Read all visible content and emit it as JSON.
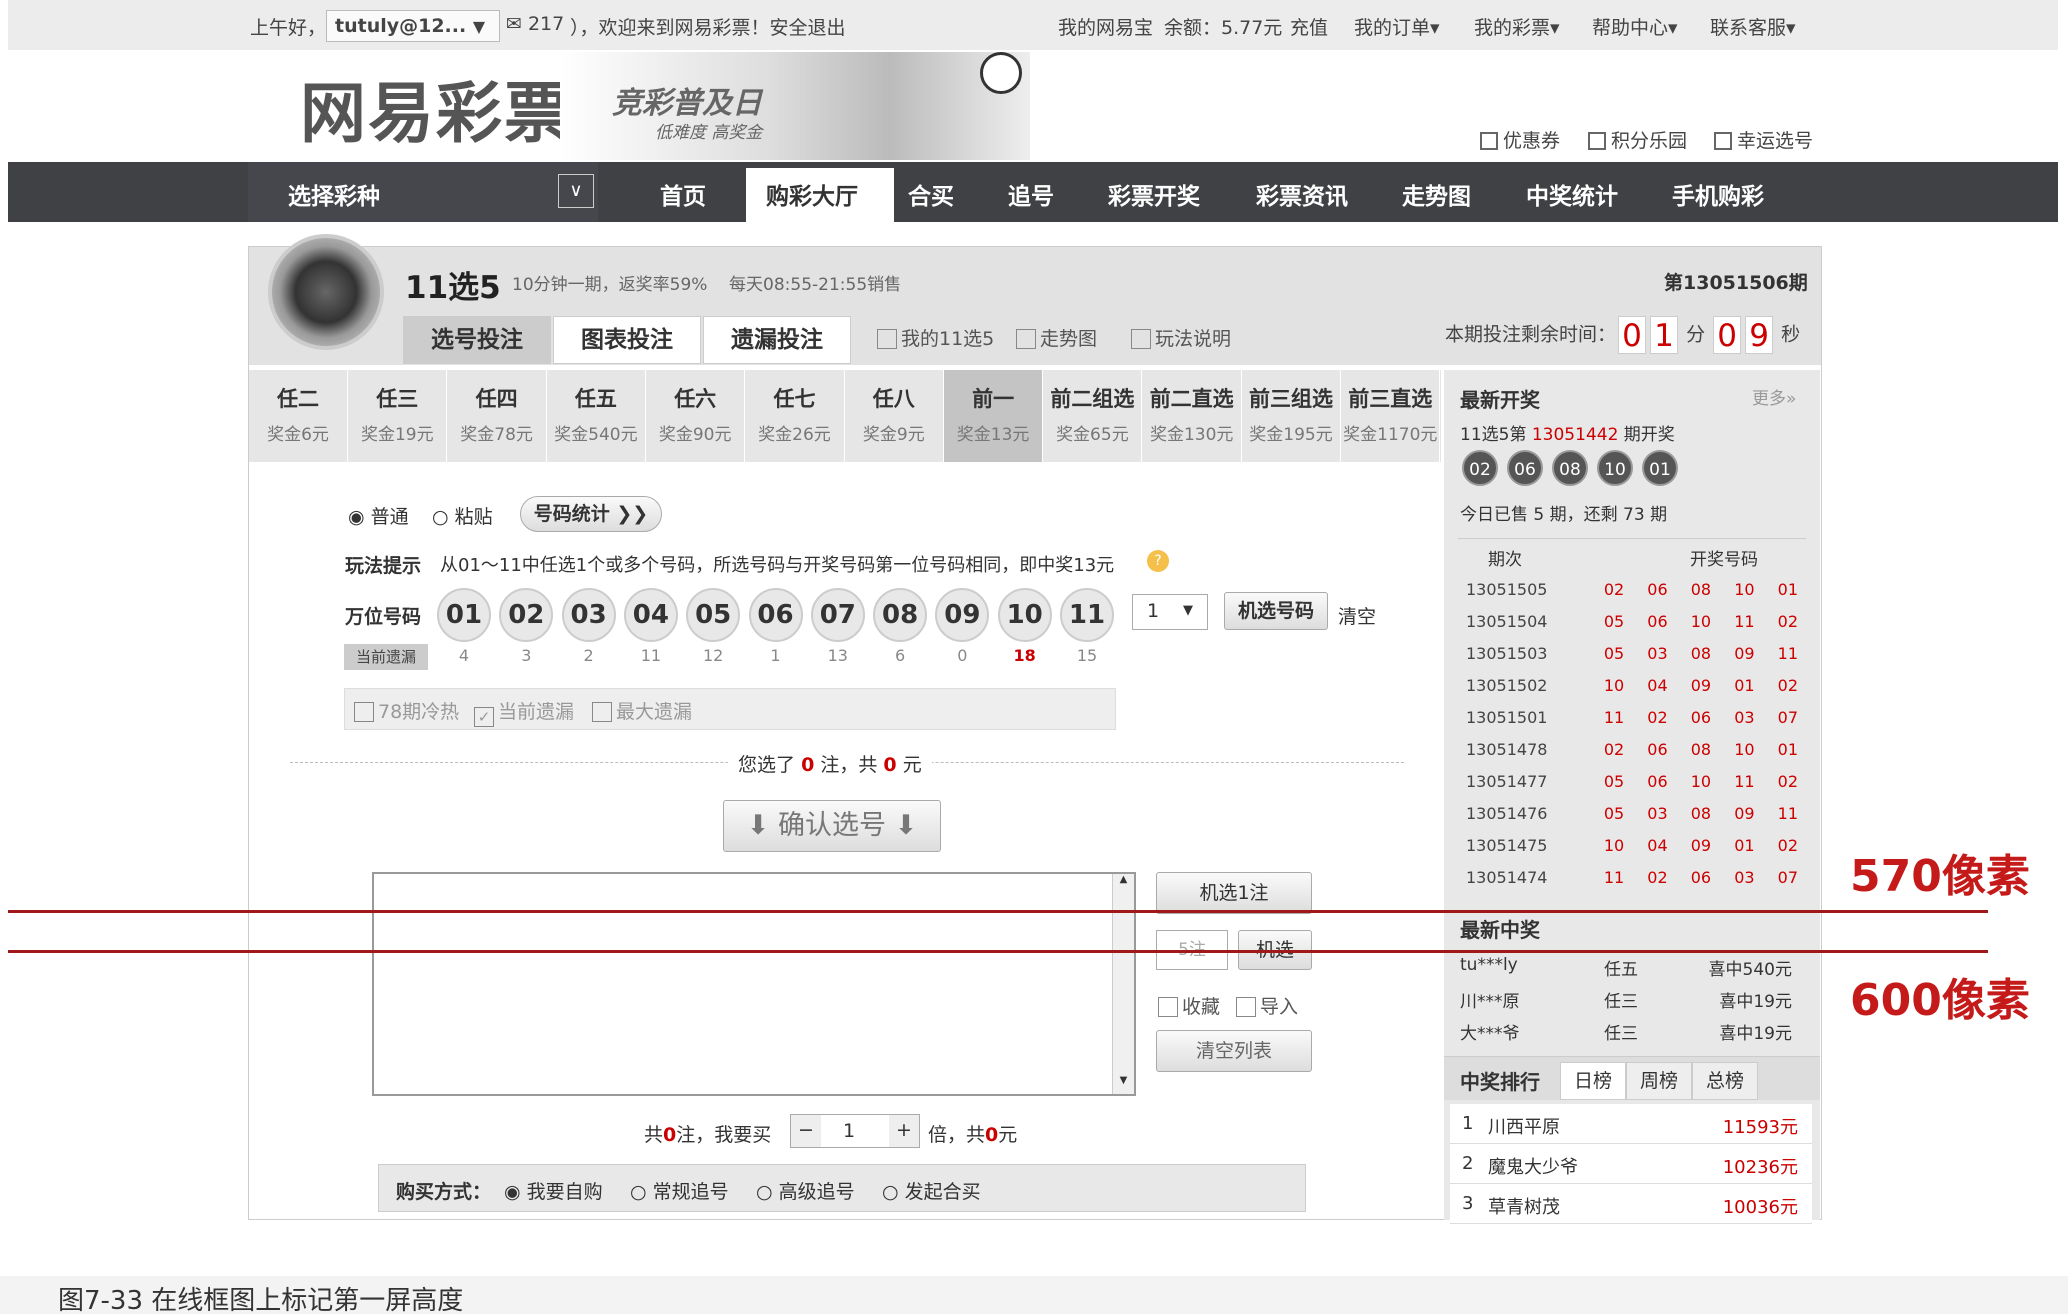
{
  "topbar": {
    "greeting": "上午好，",
    "user": "tutuly@12...",
    "user_caret": "▼",
    "mail": "✉ 217",
    "welcome": "），欢迎来到网易彩票！安全退出",
    "mywallet": "我的网易宝",
    "balance": "余额：5.77元",
    "recharge": "充值",
    "orders": "我的订单▾",
    "mylottery": "我的彩票▾",
    "help": "帮助中心▾",
    "contact": "联系客服▾"
  },
  "brand": {
    "logo": "网易彩票",
    "promo_title": "竞彩普及日",
    "promo_sub": "低难度 高奖金"
  },
  "quicklinks": [
    "优惠券",
    "积分乐园",
    "幸运选号"
  ],
  "nav": {
    "select_label": "选择彩种",
    "select_caret": "∨",
    "items": [
      "首页",
      "购彩大厅",
      "合买",
      "追号",
      "彩票开奖",
      "彩票资讯",
      "走势图",
      "中奖统计",
      "手机购彩"
    ],
    "active": "购彩大厅"
  },
  "lottery": {
    "title": "11选5",
    "subtitle": "10分钟一期，返奖率59%",
    "hours": "每天08:55-21:55销售",
    "period": "第13051506期",
    "tabs": [
      "选号投注",
      "图表投注",
      "遗漏投注"
    ],
    "links": [
      "我的11选5",
      "走势图",
      "玩法说明"
    ],
    "timer_label": "本期投注剩余时间：",
    "min_digits": [
      "0",
      "1"
    ],
    "min_unit": "分",
    "sec_digits": [
      "0",
      "9"
    ],
    "sec_unit": "秒"
  },
  "play_types": [
    {
      "name": "任二",
      "prize": "奖金6元"
    },
    {
      "name": "任三",
      "prize": "奖金19元"
    },
    {
      "name": "任四",
      "prize": "奖金78元"
    },
    {
      "name": "任五",
      "prize": "奖金540元"
    },
    {
      "name": "任六",
      "prize": "奖金90元"
    },
    {
      "name": "任七",
      "prize": "奖金26元"
    },
    {
      "name": "任八",
      "prize": "奖金9元"
    },
    {
      "name": "前一",
      "prize": "奖金13元"
    },
    {
      "name": "前二组选",
      "prize": "奖金65元"
    },
    {
      "name": "前二直选",
      "prize": "奖金130元"
    },
    {
      "name": "前三组选",
      "prize": "奖金195元"
    },
    {
      "name": "前三直选",
      "prize": "奖金1170元"
    }
  ],
  "picker": {
    "mode_normal": "普通",
    "mode_paste": "粘贴",
    "stats": "号码统计 ❯❯",
    "hint_label": "玩法提示",
    "hint": "从01～11中任选1个或多个号码，所选号码与开奖号码第一位号码相同，即中奖13元",
    "row_label": "万位号码",
    "numbers": [
      "01",
      "02",
      "03",
      "04",
      "05",
      "06",
      "07",
      "08",
      "09",
      "10",
      "11"
    ],
    "miss_label": "当前遗漏",
    "misses": [
      "4",
      "3",
      "2",
      "11",
      "12",
      "1",
      "13",
      "6",
      "0",
      "18",
      "15"
    ],
    "count": "1",
    "random_btn": "机选号码",
    "clear": "清空",
    "opt1": "78期冷热",
    "opt2": "当前遗漏",
    "opt3": "最大遗漏"
  },
  "summary": {
    "pre": "您选了",
    "bets": "0",
    "mid": "注，共",
    "amount": "0",
    "post": "元"
  },
  "confirm": "确认选号",
  "ticket": {
    "rand1": "机选1注",
    "n_placeholder": "5注",
    "rand": "机选",
    "fav": "收藏",
    "import": "导入",
    "clearlist": "清空列表"
  },
  "multiply": {
    "pre": "共",
    "bets": "0",
    "mid": "注，我要买",
    "times": "1",
    "post1": "倍，共",
    "amount": "0",
    "post2": "元"
  },
  "buy": {
    "label": "购买方式：",
    "options": [
      "我要自购",
      "常规追号",
      "高级追号",
      "发起合买"
    ]
  },
  "latest": {
    "title": "最新开奖",
    "more": "更多»",
    "issue_pre": "11选5第",
    "issue": "13051442",
    "issue_post": "期开奖",
    "balls": [
      "02",
      "06",
      "08",
      "10",
      "01"
    ],
    "sold": "今日已售 5 期，还剩 73 期",
    "col1": "期次",
    "col2": "开奖号码",
    "rows": [
      {
        "issue": "13051505",
        "nums": "02 06 08 10 01"
      },
      {
        "issue": "13051504",
        "nums": "05 06 10 11 02"
      },
      {
        "issue": "13051503",
        "nums": "05 03 08 09 11"
      },
      {
        "issue": "13051502",
        "nums": "10 04 09 01 02"
      },
      {
        "issue": "13051501",
        "nums": "11 02 06 03 07"
      },
      {
        "issue": "13051478",
        "nums": "02 06 08 10 01"
      },
      {
        "issue": "13051477",
        "nums": "05 06 10 11 02"
      },
      {
        "issue": "13051476",
        "nums": "05 03 08 09 11"
      },
      {
        "issue": "13051475",
        "nums": "10 04 09 01 02"
      },
      {
        "issue": "13051474",
        "nums": "11 02 06 03 07"
      }
    ]
  },
  "winners": {
    "title": "最新中奖",
    "rows": [
      {
        "user": "tu***ly",
        "type": "任五",
        "prize": "喜中540元"
      },
      {
        "user": "川***原",
        "type": "任三",
        "prize": "喜中19元"
      },
      {
        "user": "大***爷",
        "type": "任三",
        "prize": "喜中19元"
      }
    ]
  },
  "ranking": {
    "title": "中奖排行",
    "tabs": [
      "日榜",
      "周榜",
      "总榜"
    ],
    "rows": [
      {
        "rank": "1",
        "user": "川西平原",
        "amount": "11593元"
      },
      {
        "rank": "2",
        "user": "魔鬼大少爷",
        "amount": "10236元"
      },
      {
        "rank": "3",
        "user": "草青树茂",
        "amount": "10036元"
      }
    ]
  },
  "annotations": {
    "line1": "570像素",
    "line2": "600像素"
  },
  "caption": "图7-33 在线框图上标记第一屏高度",
  "colors": {
    "nav_bg": "#3f4145",
    "accent_red": "#c51a1a"
  }
}
